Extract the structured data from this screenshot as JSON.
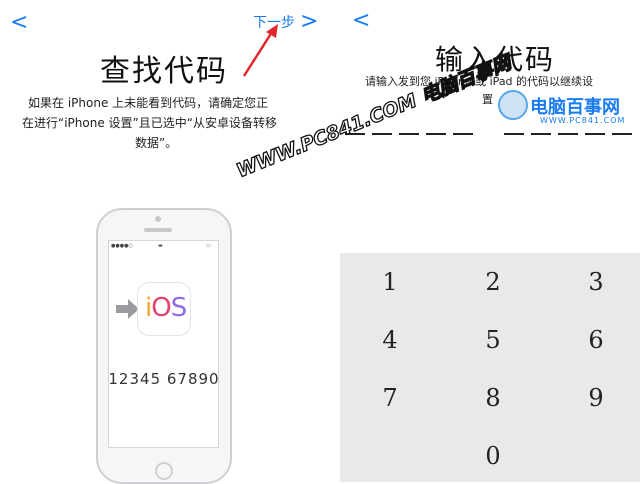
{
  "left": {
    "back_glyph": "<",
    "next_label": "下一步",
    "next_glyph": ">",
    "title": "查找代码",
    "desc_line1": "如果在 iPhone 上未能看到代码，请确定您正",
    "desc_line2": "在进行“iPhone 设置”且已选中“从安卓设备转移",
    "desc_line3": "数据”。",
    "phone": {
      "ios_label": "iOS",
      "code": "12345 67890"
    }
  },
  "right": {
    "back_glyph": "<",
    "title": "输入代码",
    "desc_line1": "请输入发到您 iPhone 或 iPad 的代码以继续设",
    "desc_line2": "置",
    "keys": [
      "1",
      "2",
      "3",
      "4",
      "5",
      "6",
      "7",
      "8",
      "9",
      "0"
    ]
  },
  "watermark": {
    "diagonal": "WWW.PC841.COM 电脑百事网",
    "logo_name": "电脑百事网",
    "logo_url": "WWW.PC841.COM"
  },
  "colors": {
    "accent": "#1a7cf0",
    "arrow_red": "#e2262c",
    "keypad_bg": "#e8e9eb"
  }
}
